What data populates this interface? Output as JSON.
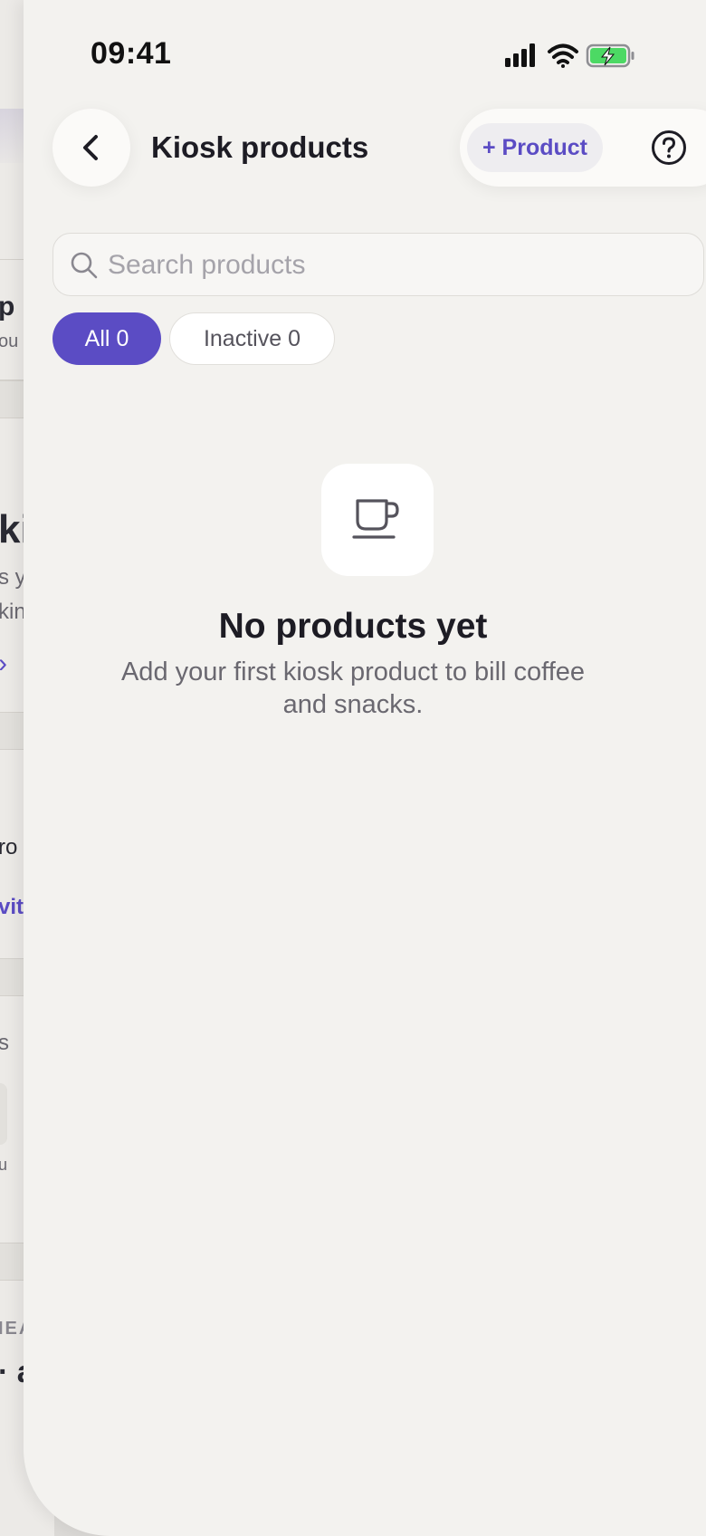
{
  "status_bar": {
    "time": "09:41"
  },
  "background_page": {
    "fragments": [
      "p",
      "ou",
      "ki",
      "s y",
      "kin",
      "ro",
      "vit",
      "s",
      "u",
      "IEA",
      "· a"
    ]
  },
  "header": {
    "title": "Kiosk products",
    "add_product_label": "+ Product"
  },
  "search": {
    "placeholder": "Search products",
    "value": ""
  },
  "filters": [
    {
      "label": "All",
      "count": "0",
      "selected": true
    },
    {
      "label": "Inactive",
      "count": "0",
      "selected": false
    }
  ],
  "empty_state": {
    "title": "No products yet",
    "subtitle": "Add your first kiosk product to bill coffee and snacks."
  },
  "colors": {
    "accent": "#5b4cc4",
    "sheet_background": "#f3f2ef",
    "battery_fill": "#4cd964"
  },
  "icons": [
    "back-chevron-icon",
    "help-icon",
    "search-icon",
    "coffee-cup-icon",
    "signal-icon",
    "wifi-icon",
    "battery-charging-icon"
  ]
}
